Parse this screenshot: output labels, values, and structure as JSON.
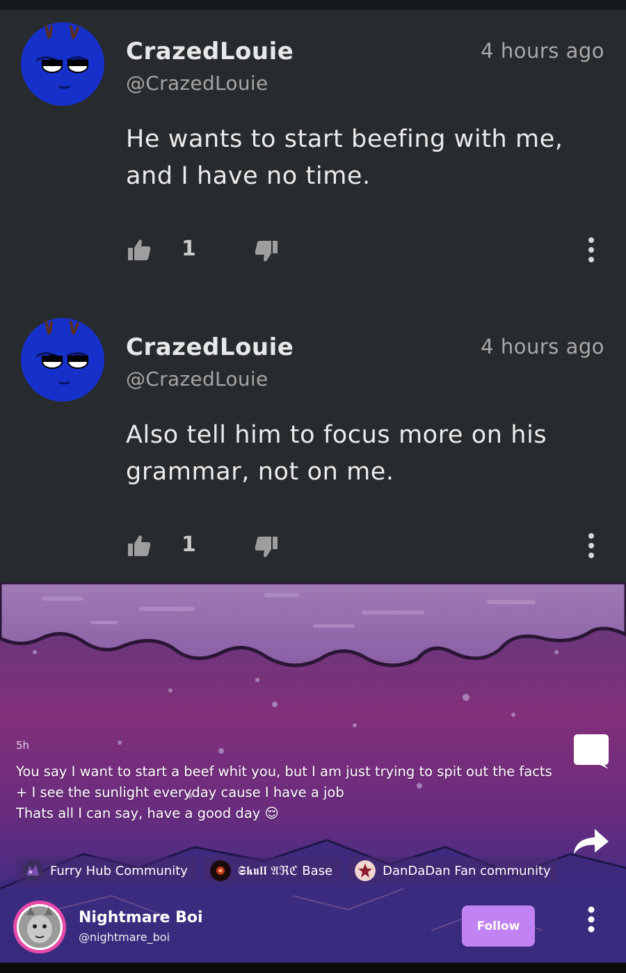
{
  "comments": [
    {
      "username": "CrazedLouie",
      "handle": "@CrazedLouie",
      "time": "4 hours ago",
      "text": "He wants to start beefing with me, and I have no time.",
      "likes": "1"
    },
    {
      "username": "CrazedLouie",
      "handle": "@CrazedLouie",
      "time": "4 hours ago",
      "text": "Also tell him to focus more on his grammar, not on me.",
      "likes": "1"
    }
  ],
  "post": {
    "time": "5h",
    "caption": "You say I want to start a beef whit you, but I am just trying to spit out the facts\n+ I see the sunlight everyday cause I have a job\nThats all I can say, have a good day 😌",
    "communities": [
      {
        "name": "Furry Hub Community",
        "icon": "furry-hub-icon"
      },
      {
        "name": "𝕾𝖐𝖚𝖑𝖑 𝔄ℜℭ Base",
        "icon": "skull-arc-icon"
      },
      {
        "name": "DanDaDan Fan community",
        "icon": "dandadan-icon"
      }
    ],
    "author": {
      "name": "Nightmare Boi",
      "handle": "@nightmare_boi"
    },
    "follow_label": "Follow"
  },
  "colors": {
    "comment_bg": "#272b2e",
    "follow_button": "#c183f4",
    "post_sky_top": "#6b2f74",
    "post_sky_bottom": "#2d2f8a"
  }
}
